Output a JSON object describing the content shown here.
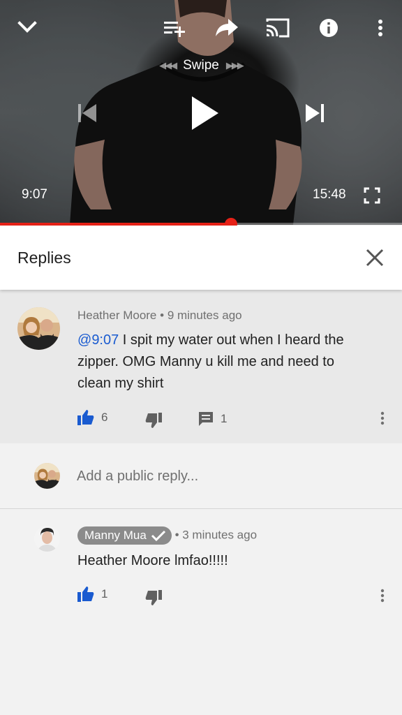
{
  "player": {
    "swipe_label": "Swipe",
    "current_time": "9:07",
    "duration": "15:48",
    "progress_fraction": 0.575
  },
  "replies": {
    "title": "Replies"
  },
  "parent_comment": {
    "author": "Heather Moore",
    "separator": "•",
    "age": "9 minutes ago",
    "mention_prefix": "@",
    "timestamp_link": "9:07",
    "text": " I spit my water out when I heard the zipper. OMG Manny u kill me and need to clean my shirt",
    "likes": "6",
    "reply_count": "1"
  },
  "reply_box": {
    "placeholder": "Add a public reply..."
  },
  "reply_comment": {
    "author": "Manny Mua",
    "separator": "•",
    "age": "3 minutes ago",
    "text": "Heather Moore lmfao!!!!!",
    "likes": "1"
  },
  "colors": {
    "accent_red": "#e62117",
    "link_blue": "#1a5bd0",
    "like_blue": "#1a5bd0"
  },
  "icons": [
    "chevron-down-icon",
    "add-to-queue-icon",
    "share-icon",
    "cast-icon",
    "info-icon",
    "more-vert-icon",
    "skip-previous-icon",
    "play-icon",
    "skip-next-icon",
    "fullscreen-icon",
    "close-icon",
    "thumb-up-icon",
    "thumb-down-icon",
    "comment-icon",
    "verified-check-icon"
  ]
}
